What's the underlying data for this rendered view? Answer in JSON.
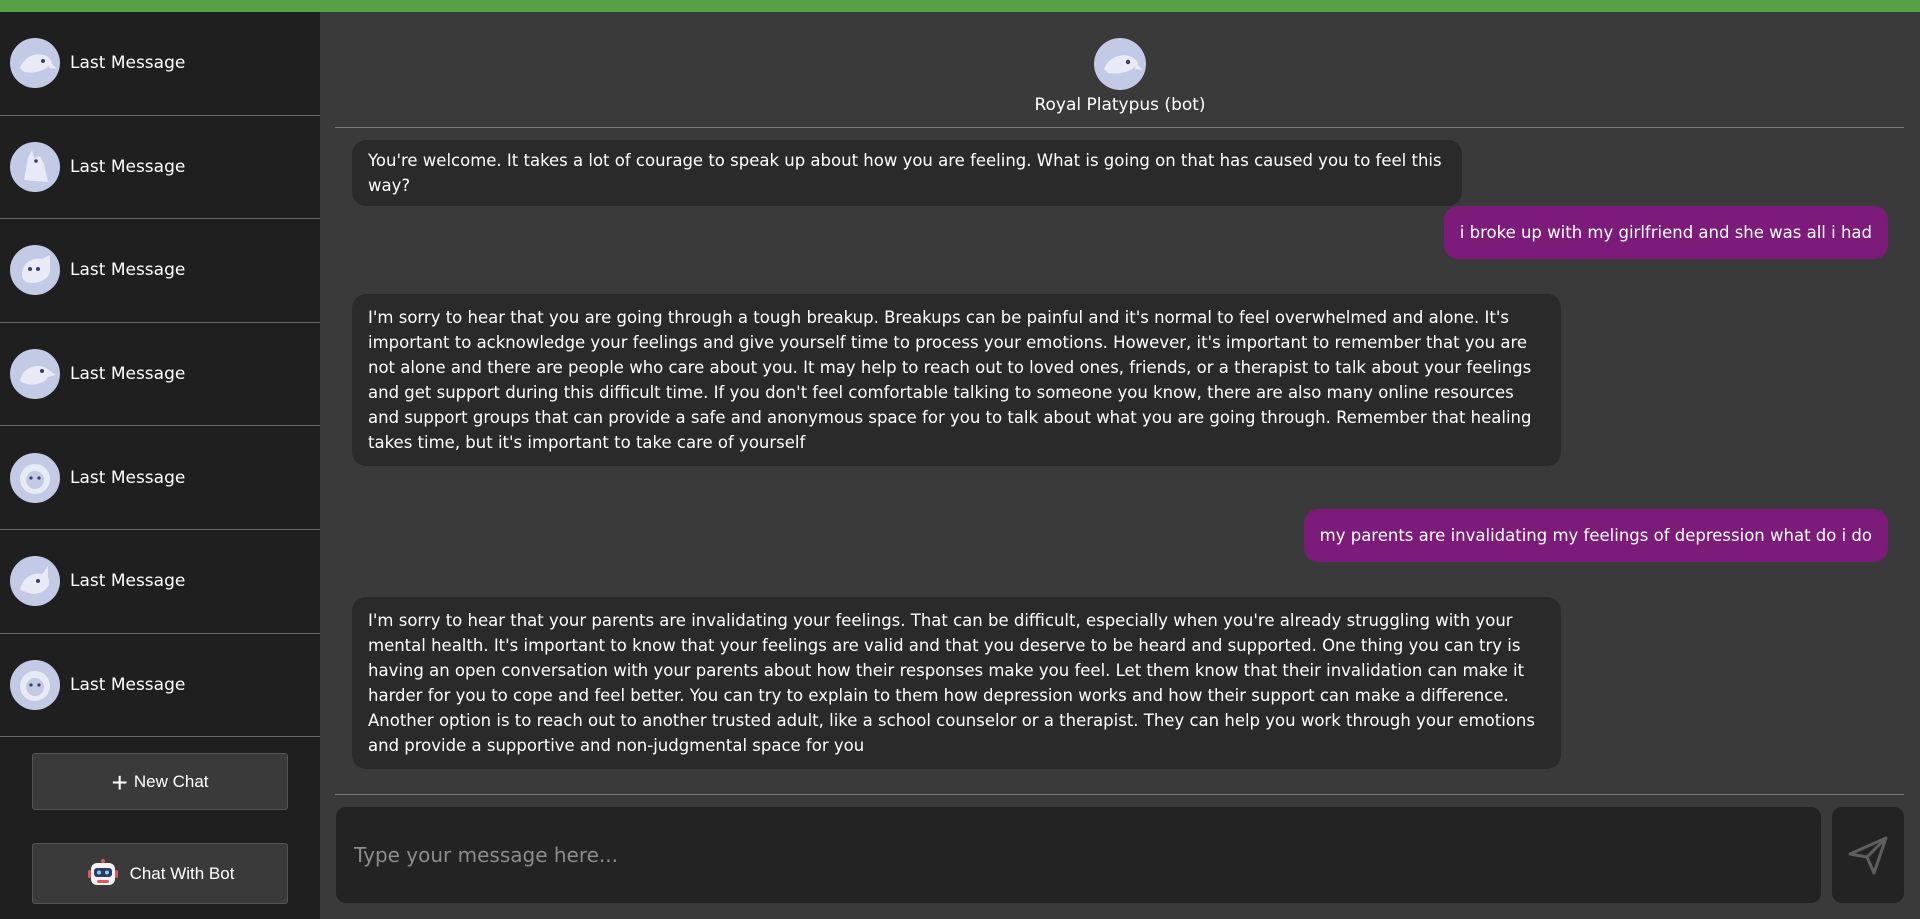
{
  "sidebar": {
    "chats": [
      {
        "label": "Last Message",
        "avatar_icon": "platypus-avatar-icon"
      },
      {
        "label": "Last Message",
        "avatar_icon": "llama-avatar-icon"
      },
      {
        "label": "Last Message",
        "avatar_icon": "dog-avatar-icon"
      },
      {
        "label": "Last Message",
        "avatar_icon": "bird-avatar-icon"
      },
      {
        "label": "Last Message",
        "avatar_icon": "lion-avatar-icon"
      },
      {
        "label": "Last Message",
        "avatar_icon": "rhino-avatar-icon"
      },
      {
        "label": "Last Message",
        "avatar_icon": "lion-avatar-icon"
      }
    ],
    "new_chat_label": "New Chat",
    "chat_with_bot_label": "Chat With Bot"
  },
  "chat": {
    "bot_name": "Royal Platypus (bot)",
    "messages": [
      {
        "from": "bot",
        "text": "You're welcome. It takes a lot of courage to speak up about how you are feeling. What is going on that has caused you to feel this way?"
      },
      {
        "from": "user",
        "text": "i broke up with my girlfriend and she was all i had"
      },
      {
        "from": "bot",
        "text": "I'm sorry to hear that you are going through a tough breakup. Breakups can be painful and it's normal to feel overwhelmed and alone. It's important to acknowledge your feelings and give yourself time to process your emotions. However, it's important to remember that you are not alone and there are people who care about you. It may help to reach out to loved ones, friends, or a therapist to talk about your feelings and get support during this difficult time. If you don't feel comfortable talking to someone you know, there are also many online resources and support groups that can provide a safe and anonymous space for you to talk about what you are going through. Remember that healing takes time, but it's important to take care of yourself"
      },
      {
        "from": "user",
        "text": "my parents are invalidating my feelings of depression what do i do"
      },
      {
        "from": "bot",
        "text": "I'm sorry to hear that your parents are invalidating your feelings. That can be difficult, especially when you're already struggling with your mental health. It's important to know that your feelings are valid and that you deserve to be heard and supported. One thing you can try is having an open conversation with your parents about how their responses make you feel. Let them know that their invalidation can make it harder for you to cope and feel better. You can try to explain to them how depression works and how their support can make a difference. Another option is to reach out to another trusted adult, like a school counselor or a therapist. They can help you work through your emotions and provide a supportive and non-judgmental space for you"
      }
    ]
  },
  "input": {
    "placeholder": "Type your message here...",
    "value": ""
  },
  "icons": {
    "send": "send-icon",
    "plus": "plus-icon",
    "bot": "robot-icon"
  },
  "colors": {
    "top_bar": "#56a046",
    "sidebar_bg": "#1f1f1f",
    "main_bg": "#3a3a3a",
    "bot_bubble": "#2a2a2a",
    "user_bubble": "#7c1b7a",
    "avatar_bg": "#c3cae6"
  }
}
